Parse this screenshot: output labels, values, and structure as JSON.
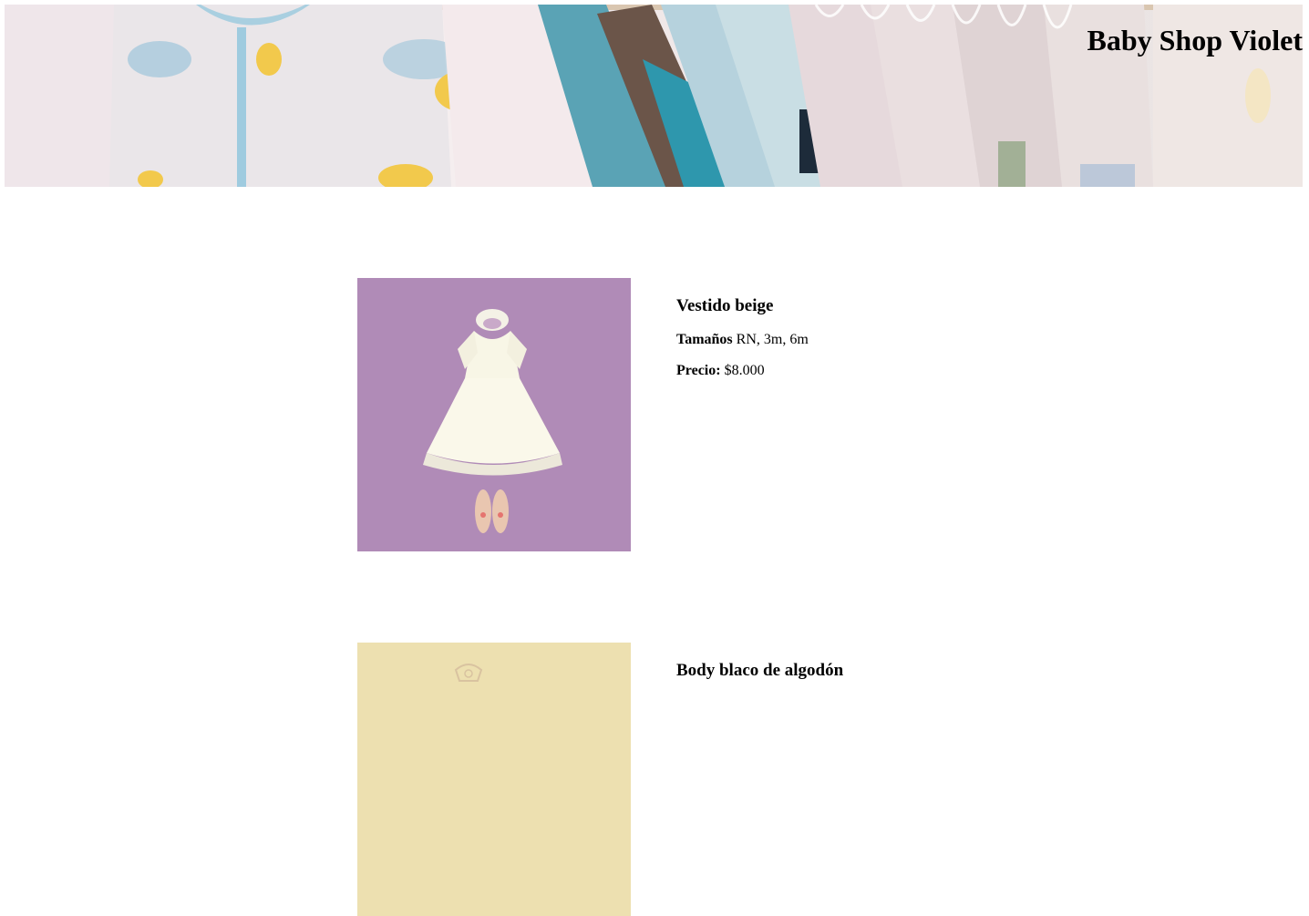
{
  "header": {
    "brand": "Baby Shop Violet",
    "banner_image": "baby-clothes-rack-banner"
  },
  "products": [
    {
      "name": "Vestido beige",
      "sizes_label": "Tamaños",
      "sizes": "RN, 3m, 6m",
      "price_label": "Precio:",
      "price": "$8.000",
      "image": "beige-dress-on-purple-rug"
    },
    {
      "name": "Body blaco de algodón",
      "image": "cotton-body-on-yellow"
    }
  ],
  "colors": {
    "dress_background": "#b48fba",
    "body_background": "#ede0b0"
  }
}
